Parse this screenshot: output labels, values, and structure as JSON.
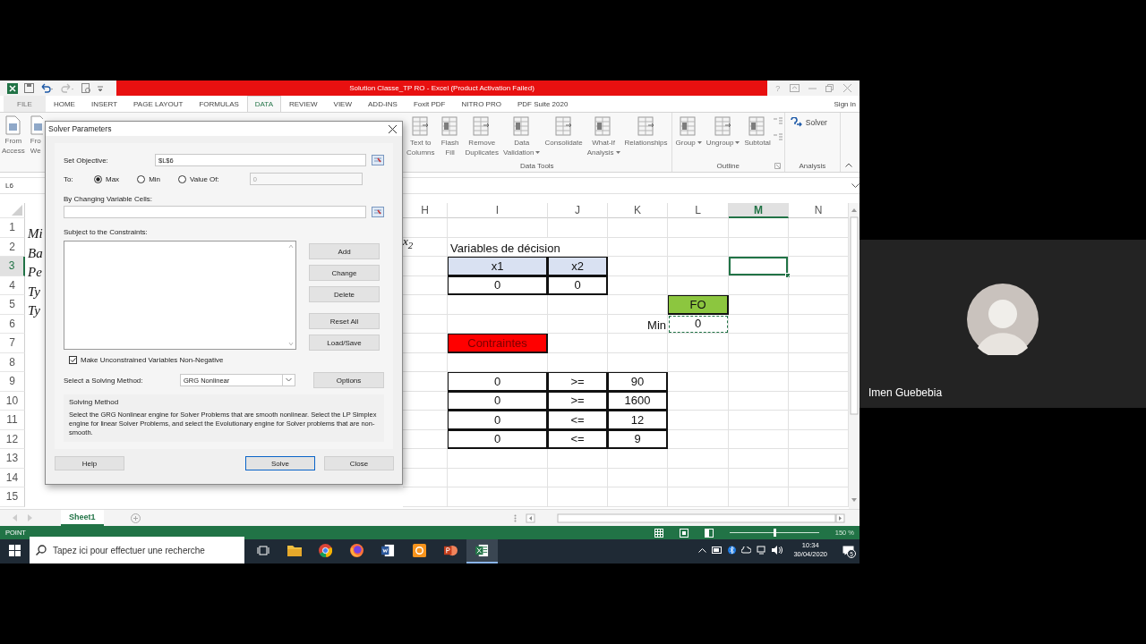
{
  "title_bar": {
    "title": "Solution Classe_TP RO - Excel (Product Activation Failed)",
    "help": "?"
  },
  "ribbon_tabs": [
    {
      "label": "FILE",
      "kind": "file",
      "selected": false
    },
    {
      "label": "HOME",
      "kind": "tab",
      "selected": false
    },
    {
      "label": "INSERT",
      "kind": "tab",
      "selected": false
    },
    {
      "label": "PAGE LAYOUT",
      "kind": "tab",
      "selected": false
    },
    {
      "label": "FORMULAS",
      "kind": "tab",
      "selected": false
    },
    {
      "label": "DATA",
      "kind": "tab",
      "selected": true
    },
    {
      "label": "REVIEW",
      "kind": "tab",
      "selected": false
    },
    {
      "label": "VIEW",
      "kind": "tab",
      "selected": false
    },
    {
      "label": "ADD-INS",
      "kind": "tab",
      "selected": false
    },
    {
      "label": "Foxit PDF",
      "kind": "tab",
      "selected": false
    },
    {
      "label": "NITRO PRO",
      "kind": "tab",
      "selected": false
    },
    {
      "label": "PDF Suite 2020",
      "kind": "tab",
      "selected": false
    }
  ],
  "sign_in": "Sign in",
  "ribbon_left": [
    {
      "lines": [
        "From",
        "Access"
      ]
    },
    {
      "lines": [
        "Fro",
        "We"
      ]
    }
  ],
  "ribbon_groups": [
    {
      "label": "Data Tools",
      "buttons": [
        {
          "lines": [
            "Text to",
            "Columns"
          ],
          "dropdown": false,
          "kind": "large"
        },
        {
          "lines": [
            "Flash",
            "Fill"
          ],
          "dropdown": false,
          "kind": "large"
        },
        {
          "lines": [
            "Remove",
            "Duplicates"
          ],
          "dropdown": false,
          "kind": "large"
        },
        {
          "lines": [
            "Data",
            "Validation"
          ],
          "dropdown": true,
          "kind": "large"
        },
        {
          "lines": [
            "Consolidate"
          ],
          "dropdown": false,
          "kind": "large"
        },
        {
          "lines": [
            "What-If",
            "Analysis"
          ],
          "dropdown": true,
          "kind": "large"
        },
        {
          "lines": [
            "Relationships"
          ],
          "dropdown": false,
          "kind": "large"
        }
      ]
    },
    {
      "label": "Outline",
      "buttons": [
        {
          "lines": [
            "Group"
          ],
          "dropdown": true,
          "kind": "large"
        },
        {
          "lines": [
            "Ungroup"
          ],
          "dropdown": true,
          "kind": "large"
        },
        {
          "lines": [
            "Subtotal"
          ],
          "dropdown": false,
          "kind": "large"
        }
      ]
    },
    {
      "label": "Analysis",
      "buttons": [
        {
          "lines": [
            "Solver"
          ],
          "kind": "small"
        }
      ]
    }
  ],
  "name_box": "L6",
  "sheet": {
    "columns": [
      {
        "label": "H",
        "selected": false
      },
      {
        "label": "I",
        "selected": false
      },
      {
        "label": "J",
        "selected": false
      },
      {
        "label": "K",
        "selected": false
      },
      {
        "label": "L",
        "selected": false
      },
      {
        "label": "M",
        "selected": true
      },
      {
        "label": "N",
        "selected": false
      }
    ],
    "rows": [
      {
        "number": "1",
        "selected": false,
        "fragment": "Mi",
        "cells": [
          {
            "kind": "plain"
          },
          {
            "kind": "plain"
          },
          {
            "kind": "plain"
          },
          {
            "kind": "plain"
          },
          {
            "kind": "plain"
          },
          {
            "kind": "plain"
          },
          {
            "kind": "plain"
          }
        ]
      },
      {
        "number": "2",
        "selected": false,
        "fragment": "Ba",
        "cells": [
          {
            "kind": "math",
            "text": "x$_{2}$"
          },
          {
            "kind": "label",
            "text": "Variables de décision"
          },
          {
            "kind": "plain"
          },
          {
            "kind": "plain"
          },
          {
            "kind": "plain"
          },
          {
            "kind": "plain"
          },
          {
            "kind": "plain"
          }
        ]
      },
      {
        "number": "3",
        "selected": true,
        "fragment": "Pe",
        "cells": [
          {
            "kind": "plain"
          },
          {
            "kind": "header",
            "text": "x1"
          },
          {
            "kind": "header",
            "text": "x2"
          },
          {
            "kind": "plain"
          },
          {
            "kind": "plain"
          },
          {
            "kind": "active"
          },
          {
            "kind": "plain"
          }
        ]
      },
      {
        "number": "4",
        "selected": false,
        "fragment": "Ty",
        "cells": [
          {
            "kind": "plain"
          },
          {
            "kind": "boxed",
            "text": "0"
          },
          {
            "kind": "boxed",
            "text": "0"
          },
          {
            "kind": "plain"
          },
          {
            "kind": "plain"
          },
          {
            "kind": "plain"
          },
          {
            "kind": "plain"
          }
        ]
      },
      {
        "number": "5",
        "selected": false,
        "fragment": "Ty",
        "cells": [
          {
            "kind": "plain"
          },
          {
            "kind": "plain"
          },
          {
            "kind": "plain"
          },
          {
            "kind": "plain"
          },
          {
            "kind": "fo",
            "text": "FO"
          },
          {
            "kind": "plain"
          },
          {
            "kind": "plain"
          }
        ]
      },
      {
        "number": "6",
        "selected": false,
        "cells": [
          {
            "kind": "plain"
          },
          {
            "kind": "plain"
          },
          {
            "kind": "plain"
          },
          {
            "kind": "right",
            "text": "Min"
          },
          {
            "kind": "marquee",
            "text": "0"
          },
          {
            "kind": "plain"
          },
          {
            "kind": "plain"
          }
        ]
      },
      {
        "number": "7",
        "selected": false,
        "cells": [
          {
            "kind": "plain"
          },
          {
            "kind": "red",
            "text": "Contraintes"
          },
          {
            "kind": "plain"
          },
          {
            "kind": "plain"
          },
          {
            "kind": "plain"
          },
          {
            "kind": "plain"
          },
          {
            "kind": "plain"
          }
        ]
      },
      {
        "number": "8",
        "selected": false,
        "cells": [
          {
            "kind": "plain"
          },
          {
            "kind": "plain"
          },
          {
            "kind": "plain"
          },
          {
            "kind": "plain"
          },
          {
            "kind": "plain"
          },
          {
            "kind": "plain"
          },
          {
            "kind": "plain"
          }
        ]
      },
      {
        "number": "9",
        "selected": false,
        "cells": [
          {
            "kind": "plain"
          },
          {
            "kind": "boxed",
            "text": "0"
          },
          {
            "kind": "boxed",
            "text": ">="
          },
          {
            "kind": "boxed",
            "text": "90"
          },
          {
            "kind": "plain"
          },
          {
            "kind": "plain"
          },
          {
            "kind": "plain"
          }
        ]
      },
      {
        "number": "10",
        "selected": false,
        "cells": [
          {
            "kind": "plain"
          },
          {
            "kind": "boxed",
            "text": "0"
          },
          {
            "kind": "boxed",
            "text": ">="
          },
          {
            "kind": "boxed",
            "text": "1600"
          },
          {
            "kind": "plain"
          },
          {
            "kind": "plain"
          },
          {
            "kind": "plain"
          }
        ]
      },
      {
        "number": "11",
        "selected": false,
        "cells": [
          {
            "kind": "plain"
          },
          {
            "kind": "boxed",
            "text": "0"
          },
          {
            "kind": "boxed",
            "text": "<="
          },
          {
            "kind": "boxed",
            "text": "12"
          },
          {
            "kind": "plain"
          },
          {
            "kind": "plain"
          },
          {
            "kind": "plain"
          }
        ]
      },
      {
        "number": "12",
        "selected": false,
        "cells": [
          {
            "kind": "plain"
          },
          {
            "kind": "boxed",
            "text": "0"
          },
          {
            "kind": "boxed",
            "text": "<="
          },
          {
            "kind": "boxed",
            "text": "9"
          },
          {
            "kind": "plain"
          },
          {
            "kind": "plain"
          },
          {
            "kind": "plain"
          }
        ]
      },
      {
        "number": "13",
        "selected": false,
        "cells": [
          {
            "kind": "plain"
          },
          {
            "kind": "plain"
          },
          {
            "kind": "plain"
          },
          {
            "kind": "plain"
          },
          {
            "kind": "plain"
          },
          {
            "kind": "plain"
          },
          {
            "kind": "plain"
          }
        ]
      },
      {
        "number": "14",
        "selected": false,
        "cells": [
          {
            "kind": "plain"
          },
          {
            "kind": "plain"
          },
          {
            "kind": "plain"
          },
          {
            "kind": "plain"
          },
          {
            "kind": "plain"
          },
          {
            "kind": "plain"
          },
          {
            "kind": "plain"
          }
        ]
      },
      {
        "number": "15",
        "selected": false,
        "cells": [
          {
            "kind": "plain"
          },
          {
            "kind": "plain"
          },
          {
            "kind": "plain"
          },
          {
            "kind": "plain"
          },
          {
            "kind": "plain"
          },
          {
            "kind": "plain"
          },
          {
            "kind": "plain"
          }
        ]
      }
    ],
    "tabs": [
      {
        "label": "Sheet1",
        "selected": true
      }
    ]
  },
  "dialog": {
    "title": "Solver Parameters",
    "objective": {
      "label": "Set Objective:",
      "value": "$L$6"
    },
    "to": {
      "label": "To:",
      "options": [
        {
          "label": "Max",
          "selected": true
        },
        {
          "label": "Min",
          "selected": false
        },
        {
          "label": "Value Of:",
          "selected": false
        }
      ],
      "value_field": {
        "value": "0",
        "disabled": true
      }
    },
    "changing_cells": {
      "label": "By Changing Variable Cells:"
    },
    "constraints": {
      "label": "Subject to the Constraints:",
      "buttons": [
        "Add",
        "Change",
        "Delete",
        "Reset All",
        "Load/Save"
      ]
    },
    "non_negative": {
      "label": "Make Unconstrained Variables Non-Negative",
      "checked": true
    },
    "method": {
      "label": "Select a Solving Method:",
      "value": "GRG Nonlinear",
      "options_button": "Options"
    },
    "description": {
      "title": "Solving Method",
      "text": "Select the GRG Nonlinear engine for Solver Problems that are smooth nonlinear. Select the LP Simplex engine for linear Solver Problems, and select the Evolutionary engine for Solver problems that are non-smooth."
    },
    "footer": [
      {
        "label": "Help",
        "default": false
      },
      {
        "label": "Solve",
        "default": true
      },
      {
        "label": "Close",
        "default": false
      }
    ]
  },
  "status_bar": {
    "mode": "POINT",
    "zoom": {
      "level": 0.5,
      "reading": "150 %"
    }
  },
  "taskbar": {
    "search": {
      "placeholder": "Tapez ici pour effectuer une recherche"
    },
    "apps": [
      {
        "kind": "task-view",
        "selected": false
      },
      {
        "kind": "folder",
        "selected": false
      },
      {
        "kind": "chrome",
        "selected": false
      },
      {
        "kind": "firefox",
        "selected": false
      },
      {
        "kind": "word",
        "selected": false
      },
      {
        "kind": "orange",
        "selected": false
      },
      {
        "kind": "powerpoint",
        "selected": false
      },
      {
        "kind": "excel",
        "selected": true
      }
    ],
    "time": "10:34",
    "date": "30/04/2020",
    "notifications": "5"
  },
  "participant": {
    "name": "Imen Guebebia"
  }
}
